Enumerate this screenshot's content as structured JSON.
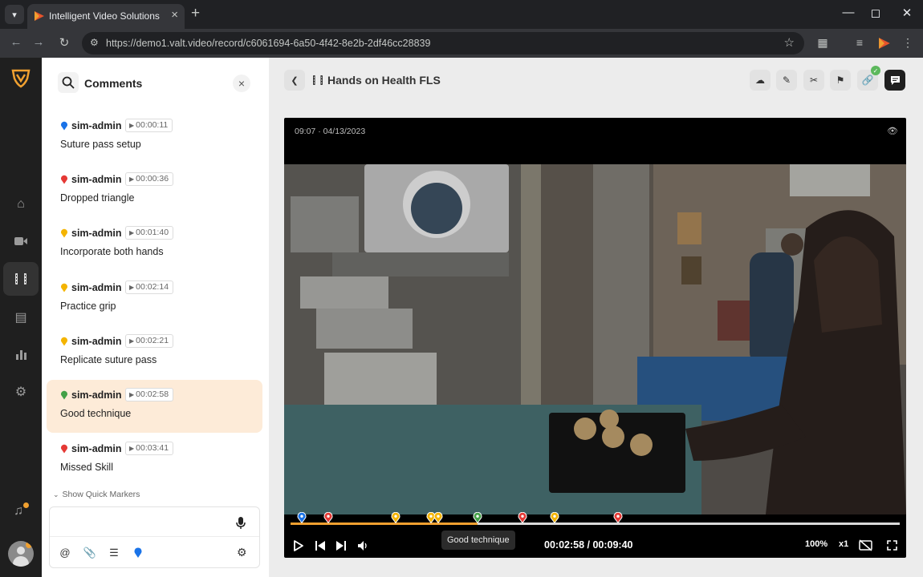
{
  "browser": {
    "tab_title": "Intelligent Video Solutions",
    "url": "https://demo1.valt.video/record/c6061694-6a50-4f42-8e2b-2df46cc28839"
  },
  "colors": {
    "accent": "#f0a030",
    "selected_bg": "#fdebd8",
    "marker_blue": "#1a73e8",
    "marker_red": "#e53935",
    "marker_yellow": "#f4b400",
    "marker_green": "#43a047"
  },
  "icons": {
    "rail": [
      "home-icon",
      "camera-icon",
      "film-icon",
      "schedule-icon",
      "chart-icon",
      "settings-icon",
      "bell-icon",
      "user-icon"
    ],
    "header_actions": [
      "cloud-download-icon",
      "pencil-icon",
      "scissors-icon",
      "comment-flag-icon",
      "link-icon",
      "comments-icon"
    ],
    "player_controls": [
      "play-icon",
      "skip-back-icon",
      "skip-forward-icon",
      "volume-icon",
      "captions-off-icon",
      "fullscreen-icon"
    ]
  },
  "panel": {
    "title": "Comments",
    "comments": [
      {
        "author": "sim-admin",
        "time": "00:00:11",
        "text": "Suture pass setup",
        "color": "blue"
      },
      {
        "author": "sim-admin",
        "time": "00:00:36",
        "text": "Dropped triangle",
        "color": "red"
      },
      {
        "author": "sim-admin",
        "time": "00:01:40",
        "text": "Incorporate both hands",
        "color": "yellow"
      },
      {
        "author": "sim-admin",
        "time": "00:02:14",
        "text": "Practice grip",
        "color": "yellow"
      },
      {
        "author": "sim-admin",
        "time": "00:02:21",
        "text": "Replicate suture pass",
        "color": "yellow"
      },
      {
        "author": "sim-admin",
        "time": "00:02:58",
        "text": "Good technique",
        "color": "green",
        "selected": true
      },
      {
        "author": "sim-admin",
        "time": "00:03:41",
        "text": "Missed Skill",
        "color": "red"
      }
    ],
    "quick_markers_label": "Show Quick Markers",
    "composer_placeholder": ""
  },
  "main": {
    "title": "Hands on Health FLS",
    "timestamp": "09:07 · 04/13/2023",
    "current_time": "00:02:58",
    "duration": "00:09:40",
    "timecode": "00:02:58 / 00:09:40",
    "progress": 0.307,
    "tooltip": "Good technique",
    "zoom": "100%",
    "speed": "x1",
    "markers": [
      {
        "pos": 0.018,
        "color": "blue"
      },
      {
        "pos": 0.062,
        "color": "red"
      },
      {
        "pos": 0.172,
        "color": "yellow"
      },
      {
        "pos": 0.231,
        "color": "yellow"
      },
      {
        "pos": 0.243,
        "color": "yellow"
      },
      {
        "pos": 0.307,
        "color": "green"
      },
      {
        "pos": 0.381,
        "color": "red"
      },
      {
        "pos": 0.434,
        "color": "yellow"
      },
      {
        "pos": 0.537,
        "color": "red"
      }
    ]
  }
}
